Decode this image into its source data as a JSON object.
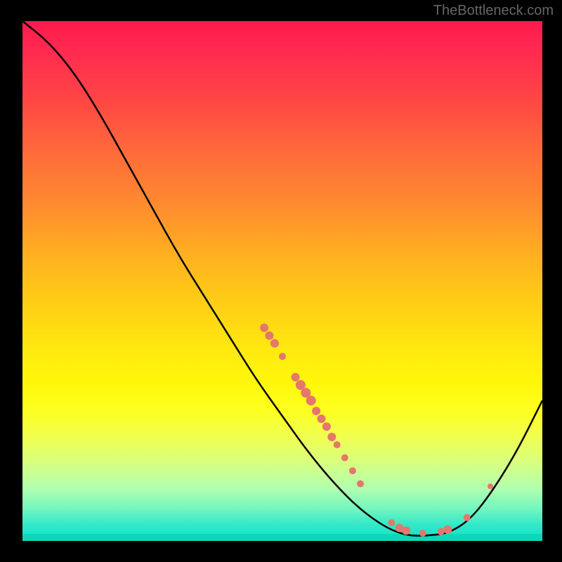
{
  "attribution": "TheBottleneck.com",
  "chart_data": {
    "type": "line",
    "title": "",
    "xlabel": "",
    "ylabel": "",
    "xlim": [
      0,
      100
    ],
    "ylim": [
      0,
      100
    ],
    "curve": [
      {
        "x": 0,
        "y": 100
      },
      {
        "x": 5,
        "y": 96
      },
      {
        "x": 10,
        "y": 90
      },
      {
        "x": 15,
        "y": 82
      },
      {
        "x": 20,
        "y": 73
      },
      {
        "x": 25,
        "y": 64
      },
      {
        "x": 30,
        "y": 55
      },
      {
        "x": 35,
        "y": 47
      },
      {
        "x": 40,
        "y": 39
      },
      {
        "x": 45,
        "y": 31
      },
      {
        "x": 50,
        "y": 24
      },
      {
        "x": 55,
        "y": 17
      },
      {
        "x": 60,
        "y": 11
      },
      {
        "x": 65,
        "y": 6
      },
      {
        "x": 70,
        "y": 2.5
      },
      {
        "x": 74,
        "y": 1
      },
      {
        "x": 78,
        "y": 1
      },
      {
        "x": 82,
        "y": 1.5
      },
      {
        "x": 86,
        "y": 4
      },
      {
        "x": 90,
        "y": 9
      },
      {
        "x": 95,
        "y": 17
      },
      {
        "x": 100,
        "y": 27
      }
    ],
    "clusters_left": [
      {
        "x": 46.5,
        "y": 41.0,
        "r": 6
      },
      {
        "x": 47.5,
        "y": 39.5,
        "r": 6
      },
      {
        "x": 48.5,
        "y": 38.0,
        "r": 6
      },
      {
        "x": 50.0,
        "y": 35.5,
        "r": 5
      },
      {
        "x": 52.5,
        "y": 31.5,
        "r": 6
      },
      {
        "x": 53.5,
        "y": 30.0,
        "r": 7
      },
      {
        "x": 54.5,
        "y": 28.5,
        "r": 7
      },
      {
        "x": 55.5,
        "y": 27.0,
        "r": 7
      },
      {
        "x": 56.5,
        "y": 25.0,
        "r": 6
      },
      {
        "x": 57.5,
        "y": 23.5,
        "r": 6
      },
      {
        "x": 58.5,
        "y": 22.0,
        "r": 6
      },
      {
        "x": 59.5,
        "y": 20.0,
        "r": 6
      },
      {
        "x": 60.5,
        "y": 18.5,
        "r": 5
      },
      {
        "x": 62.0,
        "y": 16.0,
        "r": 5
      },
      {
        "x": 63.5,
        "y": 13.5,
        "r": 5
      },
      {
        "x": 65.0,
        "y": 11.0,
        "r": 5
      }
    ],
    "clusters_bottom": [
      {
        "x": 71.0,
        "y": 3.5,
        "r": 5
      },
      {
        "x": 72.5,
        "y": 2.5,
        "r": 6
      },
      {
        "x": 73.8,
        "y": 2.0,
        "r": 6
      },
      {
        "x": 77.0,
        "y": 1.5,
        "r": 5
      },
      {
        "x": 80.5,
        "y": 1.8,
        "r": 5
      },
      {
        "x": 81.8,
        "y": 2.2,
        "r": 6
      },
      {
        "x": 85.5,
        "y": 4.5,
        "r": 5
      }
    ],
    "clusters_right": [
      {
        "x": 90.0,
        "y": 10.5,
        "r": 4
      }
    ],
    "dot_color": "#e5776c",
    "line_color": "#000000"
  }
}
